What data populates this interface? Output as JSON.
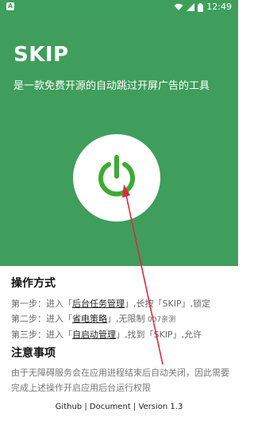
{
  "status_bar": {
    "left_icon": "A",
    "time": "12:49",
    "icons": [
      "wifi-icon",
      "signal-icon",
      "battery-icon"
    ]
  },
  "header": {
    "title": "SKIP",
    "subtitle": "是一款免费开源的自动跳过开屏广告的工具",
    "power_button_icon": "power-icon",
    "colors": {
      "background": "#3f9e5b",
      "power_icon": "#3cab33",
      "annotation_arrow": "#e0283a"
    }
  },
  "instructions": {
    "title": "操作方式",
    "steps": [
      {
        "prefix": "第一步：进入「",
        "link": "后台任务管理",
        "suffix": "」,长按「SKIP」,锁定"
      },
      {
        "prefix": "第二步：进入「",
        "link": "省电策略",
        "suffix": "」,无限制 ",
        "extra": "007亲测"
      },
      {
        "prefix": "第三步：进入「",
        "link": "自启动管理",
        "suffix": "」,找到「SKIP」,允许"
      }
    ]
  },
  "notes": {
    "title": "注意事项",
    "text": "由于无障碍服务会在应用进程结束后自动关闭，因此需要完成上述操作开启应用后台运行权限"
  },
  "footer": {
    "github": "Github",
    "separator": "|",
    "document": "Document",
    "version": "Version 1.3"
  }
}
